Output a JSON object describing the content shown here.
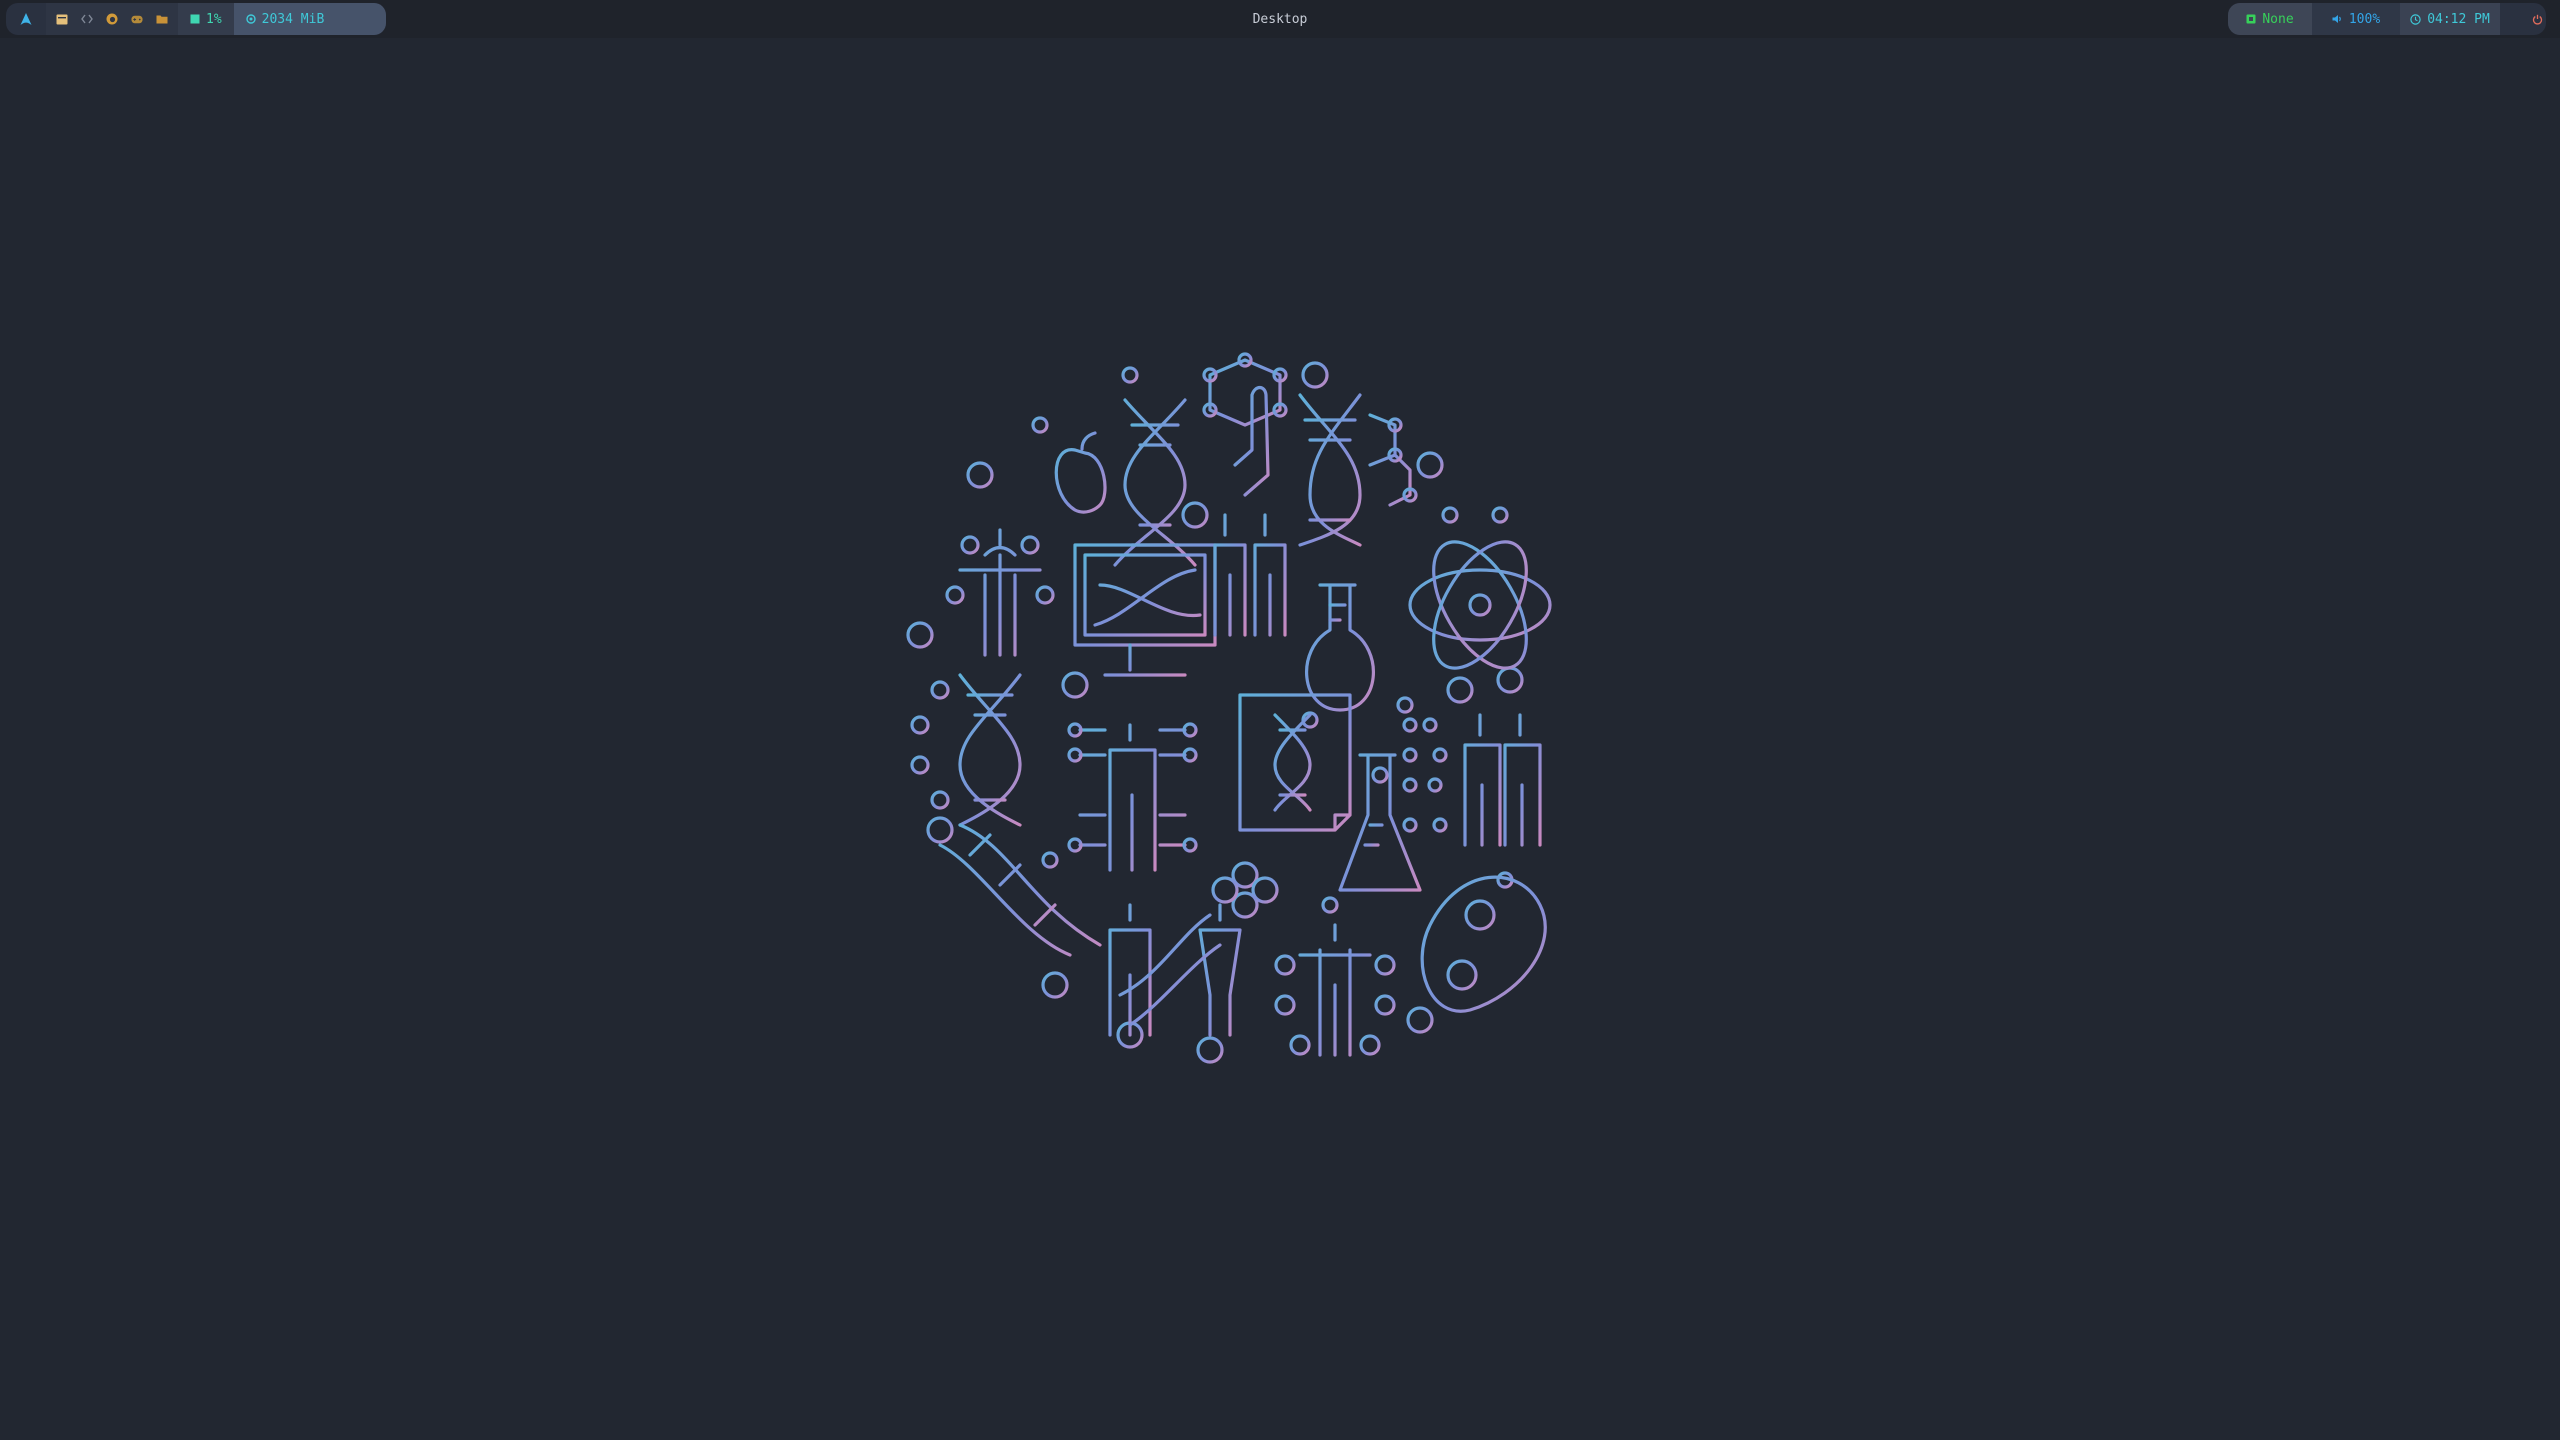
{
  "window": {
    "title": "Desktop"
  },
  "topbar": {
    "launcher": {
      "icon": "arch-linux-logo-icon"
    },
    "workspaces": [
      {
        "icon": "terminal-icon",
        "color": "#e5c07b"
      },
      {
        "icon": "code-icon",
        "color": "#7f8796"
      },
      {
        "icon": "firefox-icon",
        "color": "#d19a3a"
      },
      {
        "icon": "gamepad-icon",
        "color": "#b48a3a"
      },
      {
        "icon": "folder-icon",
        "color": "#c99238"
      }
    ],
    "cpu": {
      "icon": "cpu-icon",
      "text": "1%"
    },
    "memory": {
      "icon": "memory-icon",
      "text": "2034 MiB"
    },
    "network": {
      "icon": "network-icon",
      "text": "None"
    },
    "volume": {
      "icon": "speaker-icon",
      "text": "100%"
    },
    "clock": {
      "icon": "clock-icon",
      "text": "04:12 PM"
    },
    "power": {
      "icon": "power-icon",
      "color": "#e06c5c"
    }
  },
  "desktop": {
    "wallpaper": {
      "description_icon": "genetics-science-circle-icon",
      "colors": [
        "#5fb0d8",
        "#7f8fd8",
        "#c98ac0"
      ]
    }
  }
}
